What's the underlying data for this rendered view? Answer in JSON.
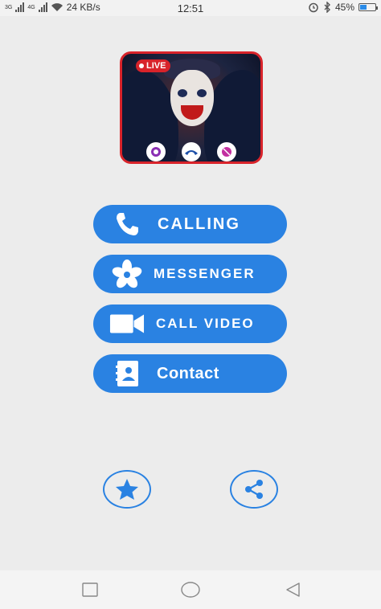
{
  "status_bar": {
    "network": "3G",
    "network2": "4G",
    "speed": "24 KB/s",
    "time": "12:51",
    "battery_percent": "45%",
    "battery_level": 0.45,
    "icons": [
      "signal-icon",
      "wifi-icon",
      "alarm-icon",
      "bluetooth-icon",
      "battery-icon"
    ]
  },
  "hero": {
    "live_label": "LIVE",
    "accent": "#d8232a"
  },
  "menu": [
    {
      "label": "CALLING",
      "icon": "phone-icon"
    },
    {
      "label": "MESSENGER",
      "icon": "asterisk-icon"
    },
    {
      "label": "CALL VIDEO",
      "icon": "video-camera-icon"
    },
    {
      "label": "Contact",
      "icon": "contact-book-icon"
    }
  ],
  "actions": [
    {
      "icon": "star-icon"
    },
    {
      "icon": "share-icon"
    }
  ],
  "navbar": {
    "icons": [
      "recent-apps-icon",
      "home-icon",
      "back-icon"
    ]
  },
  "colors": {
    "primary": "#2a82e2",
    "background": "#ececec"
  }
}
